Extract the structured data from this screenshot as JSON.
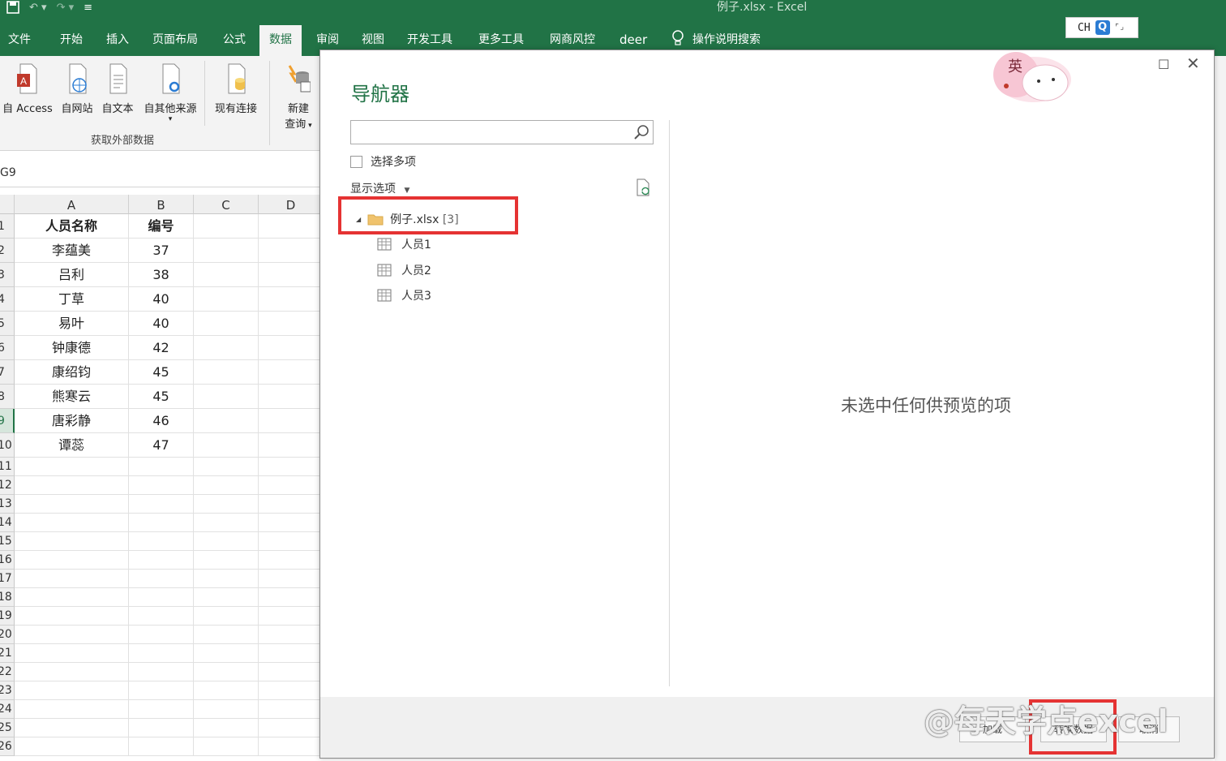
{
  "window": {
    "title": "例子.xlsx  -  Excel"
  },
  "ribbon_tabs": [
    "文件",
    "开始",
    "插入",
    "页面布局",
    "公式",
    "数据",
    "审阅",
    "视图",
    "开发工具",
    "更多工具",
    "网商风控",
    "deer"
  ],
  "active_tab": "数据",
  "tell_me": "操作说明搜索",
  "ime": {
    "lang": "CH",
    "q": "Q"
  },
  "ribbon": {
    "buttons": [
      {
        "label": "自 Access"
      },
      {
        "label": "自网站"
      },
      {
        "label": "自文本"
      },
      {
        "label": "自其他来源"
      },
      {
        "label": "现有连接"
      },
      {
        "label": "新建\n查询"
      }
    ],
    "group_label": "获取外部数据",
    "new_query_line1": "新建",
    "new_query_line2": "查询"
  },
  "name_box": "G9",
  "sheet": {
    "columns": [
      "A",
      "B",
      "C",
      "D"
    ],
    "rows": [
      {
        "num": "1",
        "a": "人员名称",
        "b": "编号"
      },
      {
        "num": "2",
        "a": "李蕴美",
        "b": "37"
      },
      {
        "num": "3",
        "a": "吕利",
        "b": "38"
      },
      {
        "num": "4",
        "a": "丁草",
        "b": "40"
      },
      {
        "num": "5",
        "a": "易叶",
        "b": "40"
      },
      {
        "num": "6",
        "a": "钟康德",
        "b": "42"
      },
      {
        "num": "7",
        "a": "康绍钧",
        "b": "45"
      },
      {
        "num": "8",
        "a": "熊寒云",
        "b": "45"
      },
      {
        "num": "9",
        "a": "唐彩静",
        "b": "46"
      },
      {
        "num": "10",
        "a": "谭蕊",
        "b": "47"
      }
    ],
    "empty_rows": [
      "11",
      "12",
      "13",
      "14",
      "15",
      "16",
      "17",
      "18",
      "19",
      "20",
      "21",
      "22",
      "23",
      "24",
      "25",
      "26"
    ]
  },
  "dialog": {
    "title": "导航器",
    "search_placeholder": "",
    "select_multiple": "选择多项",
    "display_options": "显示选项",
    "tree": {
      "root": "例子.xlsx",
      "root_count": "[3]",
      "items": [
        "人员1",
        "人员2",
        "人员3"
      ]
    },
    "empty_preview": "未选中任何供预览的项",
    "buttons": {
      "load": "加载",
      "transform": "转换数据",
      "cancel": "取消"
    },
    "watermark": "@每天学点excel",
    "sticker_text": "英"
  },
  "colors": {
    "excel_green": "#217346",
    "highlight": "#e53333"
  }
}
